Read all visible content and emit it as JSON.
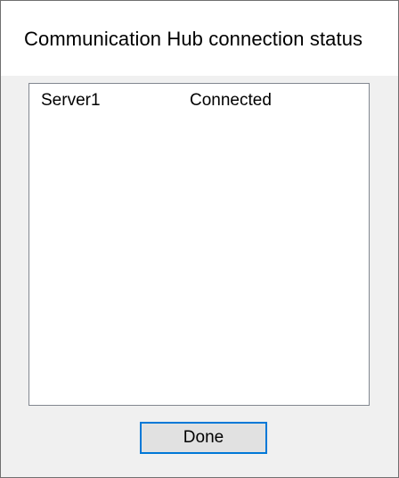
{
  "window": {
    "title": "Communication Hub connection status"
  },
  "connections": [
    {
      "name": "Server1",
      "status": "Connected"
    }
  ],
  "buttons": {
    "done_label": "Done"
  },
  "colors": {
    "focus_border": "#0078d7",
    "button_face": "#e1e1e1",
    "dialog_background": "#f0f0f0"
  }
}
